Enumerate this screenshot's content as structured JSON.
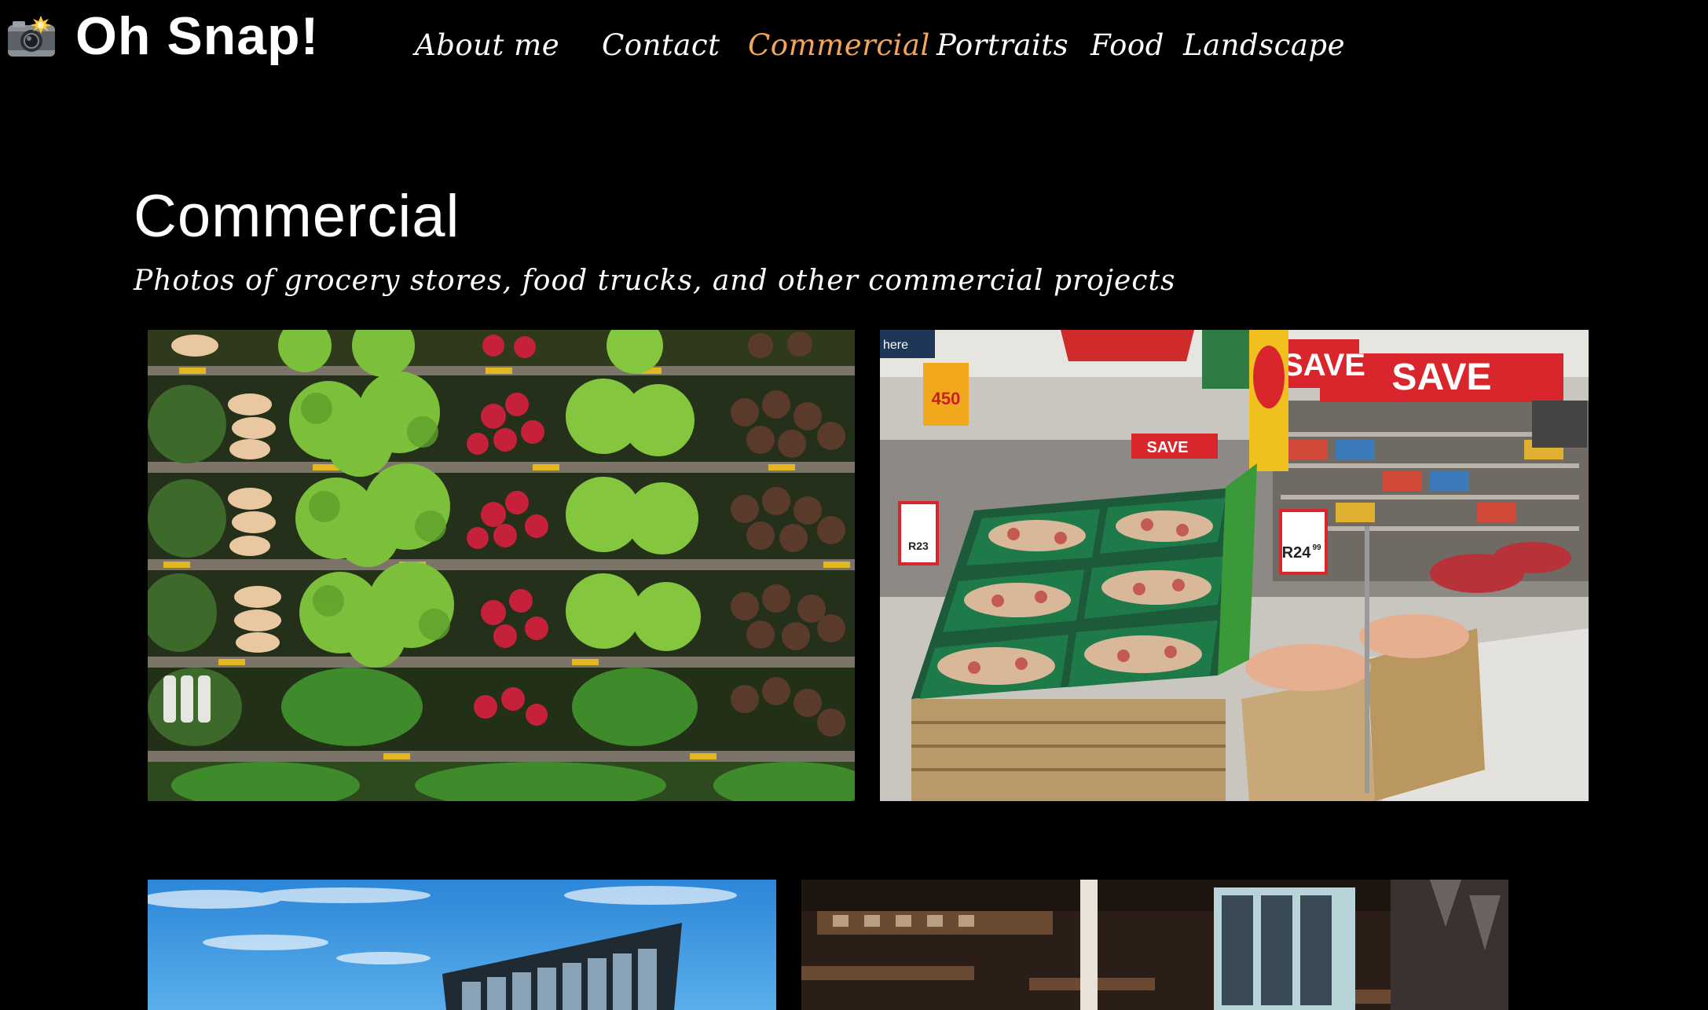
{
  "header": {
    "logo_icon": "camera-flash-icon",
    "brand": "Oh Snap!",
    "nav": [
      {
        "label": "About me",
        "active": false
      },
      {
        "label": "Contact",
        "active": false
      },
      {
        "label": "Commercial",
        "active": true
      },
      {
        "label": "Portraits",
        "active": false
      },
      {
        "label": "Food",
        "active": false
      },
      {
        "label": "Landscape",
        "active": false
      }
    ],
    "active_color": "#f5a55a"
  },
  "main": {
    "title": "Commercial",
    "subtitle": "Photos of grocery stores, food trucks, and other commercial projects"
  },
  "gallery": {
    "photo_subjects": [
      "produce-shelves",
      "supermarket-apple-display",
      "modern-building",
      "restaurant-interior"
    ],
    "supermarket_signs": {
      "banner": "SAVE",
      "banner_right": "SAVE",
      "shelf_sign": "SAVE",
      "price_left": "R23",
      "price_right": "R24",
      "price_right_cents": "99",
      "promo": "450",
      "side_label": "here"
    }
  }
}
